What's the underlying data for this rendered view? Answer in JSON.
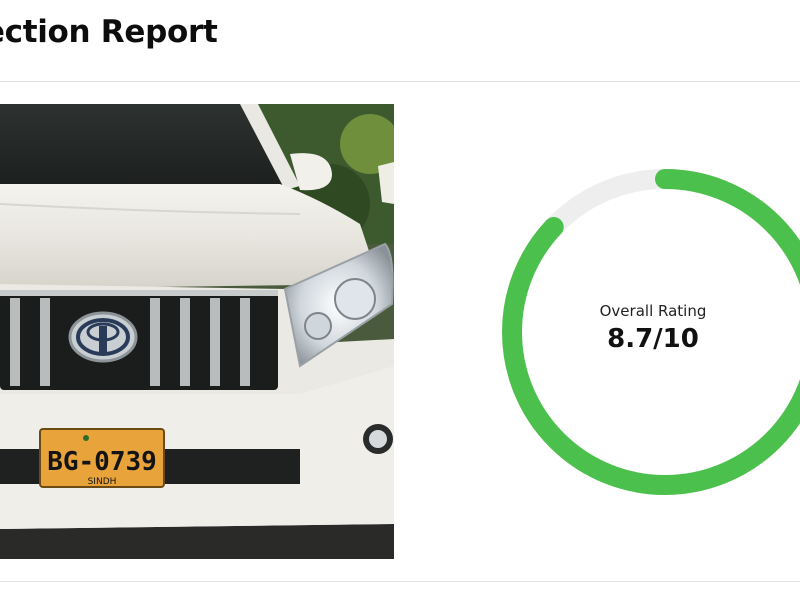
{
  "header": {
    "title": "pection Report"
  },
  "vehicle": {
    "plate_number": "BG-0739",
    "plate_region": "SINDH",
    "photo_icon": "car-front-photo"
  },
  "rating": {
    "label": "Overall Rating",
    "value_text": "8.7/10",
    "score": 8.7,
    "max": 10,
    "ring_color": "#4cc04c",
    "track_color": "#eeeeee"
  }
}
